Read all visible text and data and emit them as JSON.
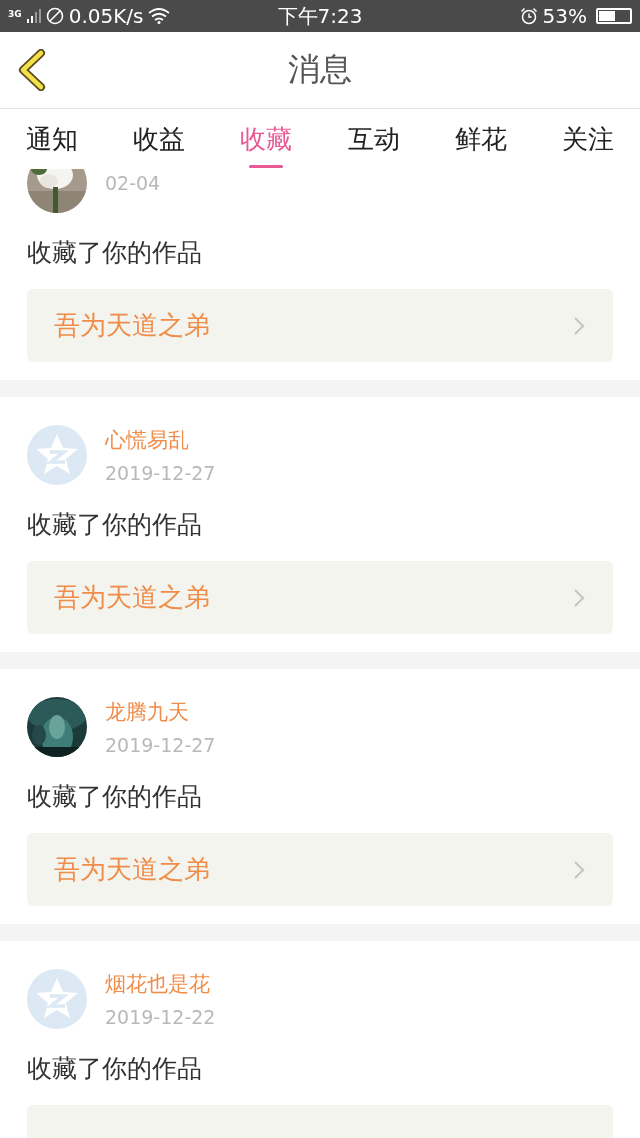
{
  "status_bar": {
    "network": "3G",
    "speed": "0.05K/s",
    "time": "下午7:23",
    "battery": "53%"
  },
  "header": {
    "title": "消息"
  },
  "tabs": [
    {
      "label": "通知",
      "selected": false
    },
    {
      "label": "收益",
      "selected": false
    },
    {
      "label": "收藏",
      "selected": true
    },
    {
      "label": "互动",
      "selected": false
    },
    {
      "label": "鲜花",
      "selected": false
    },
    {
      "label": "关注",
      "selected": false
    }
  ],
  "messages": [
    {
      "kind": "picture",
      "date": "02-04",
      "action": "收藏了你的作品",
      "work": "吾为天道之弟"
    },
    {
      "kind": "default",
      "name": "心慌易乱",
      "date": "2019-12-27",
      "action": "收藏了你的作品",
      "work": "吾为天道之弟"
    },
    {
      "kind": "picture",
      "name": "龙腾九天",
      "date": "2019-12-27",
      "action": "收藏了你的作品",
      "work": "吾为天道之弟"
    },
    {
      "kind": "default",
      "name": "烟花也是花",
      "date": "2019-12-22",
      "action": "收藏了你的作品"
    }
  ]
}
